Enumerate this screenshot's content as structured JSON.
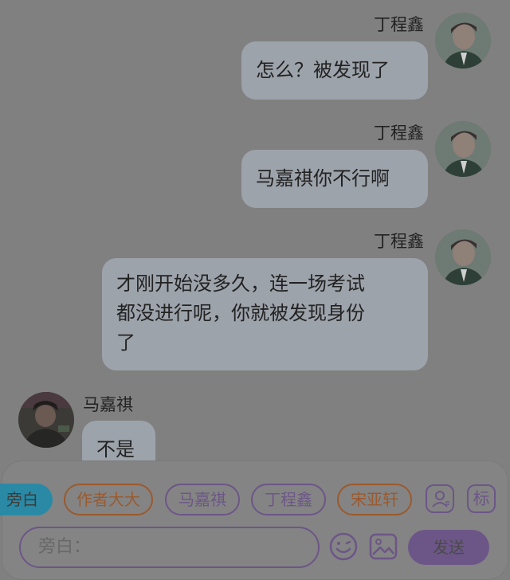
{
  "messages": [
    {
      "sender": "丁程鑫",
      "text": "怎么？被发现了"
    },
    {
      "sender": "丁程鑫",
      "text": "马嘉祺你不行啊"
    },
    {
      "sender": "丁程鑫",
      "lines": [
        "才刚开始没多久，连一场考试",
        "都没进行呢，你就被发现身份",
        "了"
      ]
    },
    {
      "sender": "马嘉祺",
      "text": "不是"
    }
  ],
  "roles": {
    "narrator": "旁白",
    "items": [
      "作者大大",
      "马嘉祺",
      "丁程鑫",
      "宋亚轩"
    ]
  },
  "toolbar": {
    "tag_label": "标"
  },
  "composer": {
    "placeholder": "旁白：",
    "send_label": "发送"
  },
  "colors": {
    "overlay_bg": "#808080",
    "bubble": "#9da3ab",
    "accent_purple": "#6c5687",
    "narrator_chip": "#2a8aa5",
    "chip_orange": "#9a5a2e"
  }
}
